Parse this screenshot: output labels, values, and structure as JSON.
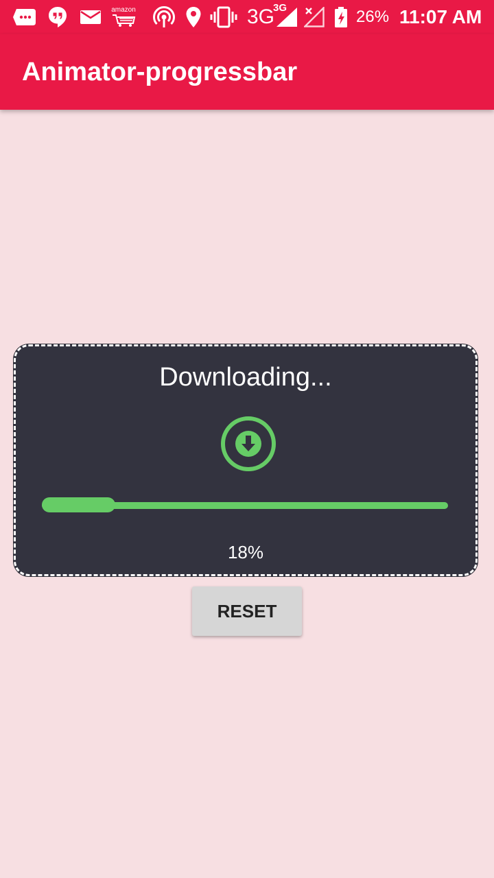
{
  "status_bar": {
    "network": "3G",
    "network_badge": "3G",
    "battery": "26%",
    "time": "11:07 AM",
    "icons": [
      "messages-icon",
      "hangouts-icon",
      "email-icon",
      "amazon-icon",
      "hotspot-icon",
      "location-icon",
      "vibrate-icon",
      "signal-icon",
      "no-signal-icon",
      "battery-charging-icon"
    ],
    "amazon_label": "amazon"
  },
  "app_bar": {
    "title": "Animator-progressbar"
  },
  "download_card": {
    "title": "Downloading...",
    "icon": "download-circle-icon",
    "progress": 0.18,
    "progress_text": "18%"
  },
  "reset_button": {
    "label": "RESET"
  },
  "colors": {
    "primary": "#e91946",
    "background": "#f7dfe2",
    "card": "#33333f",
    "progress": "#66cc66",
    "button": "#d6d6d6"
  }
}
